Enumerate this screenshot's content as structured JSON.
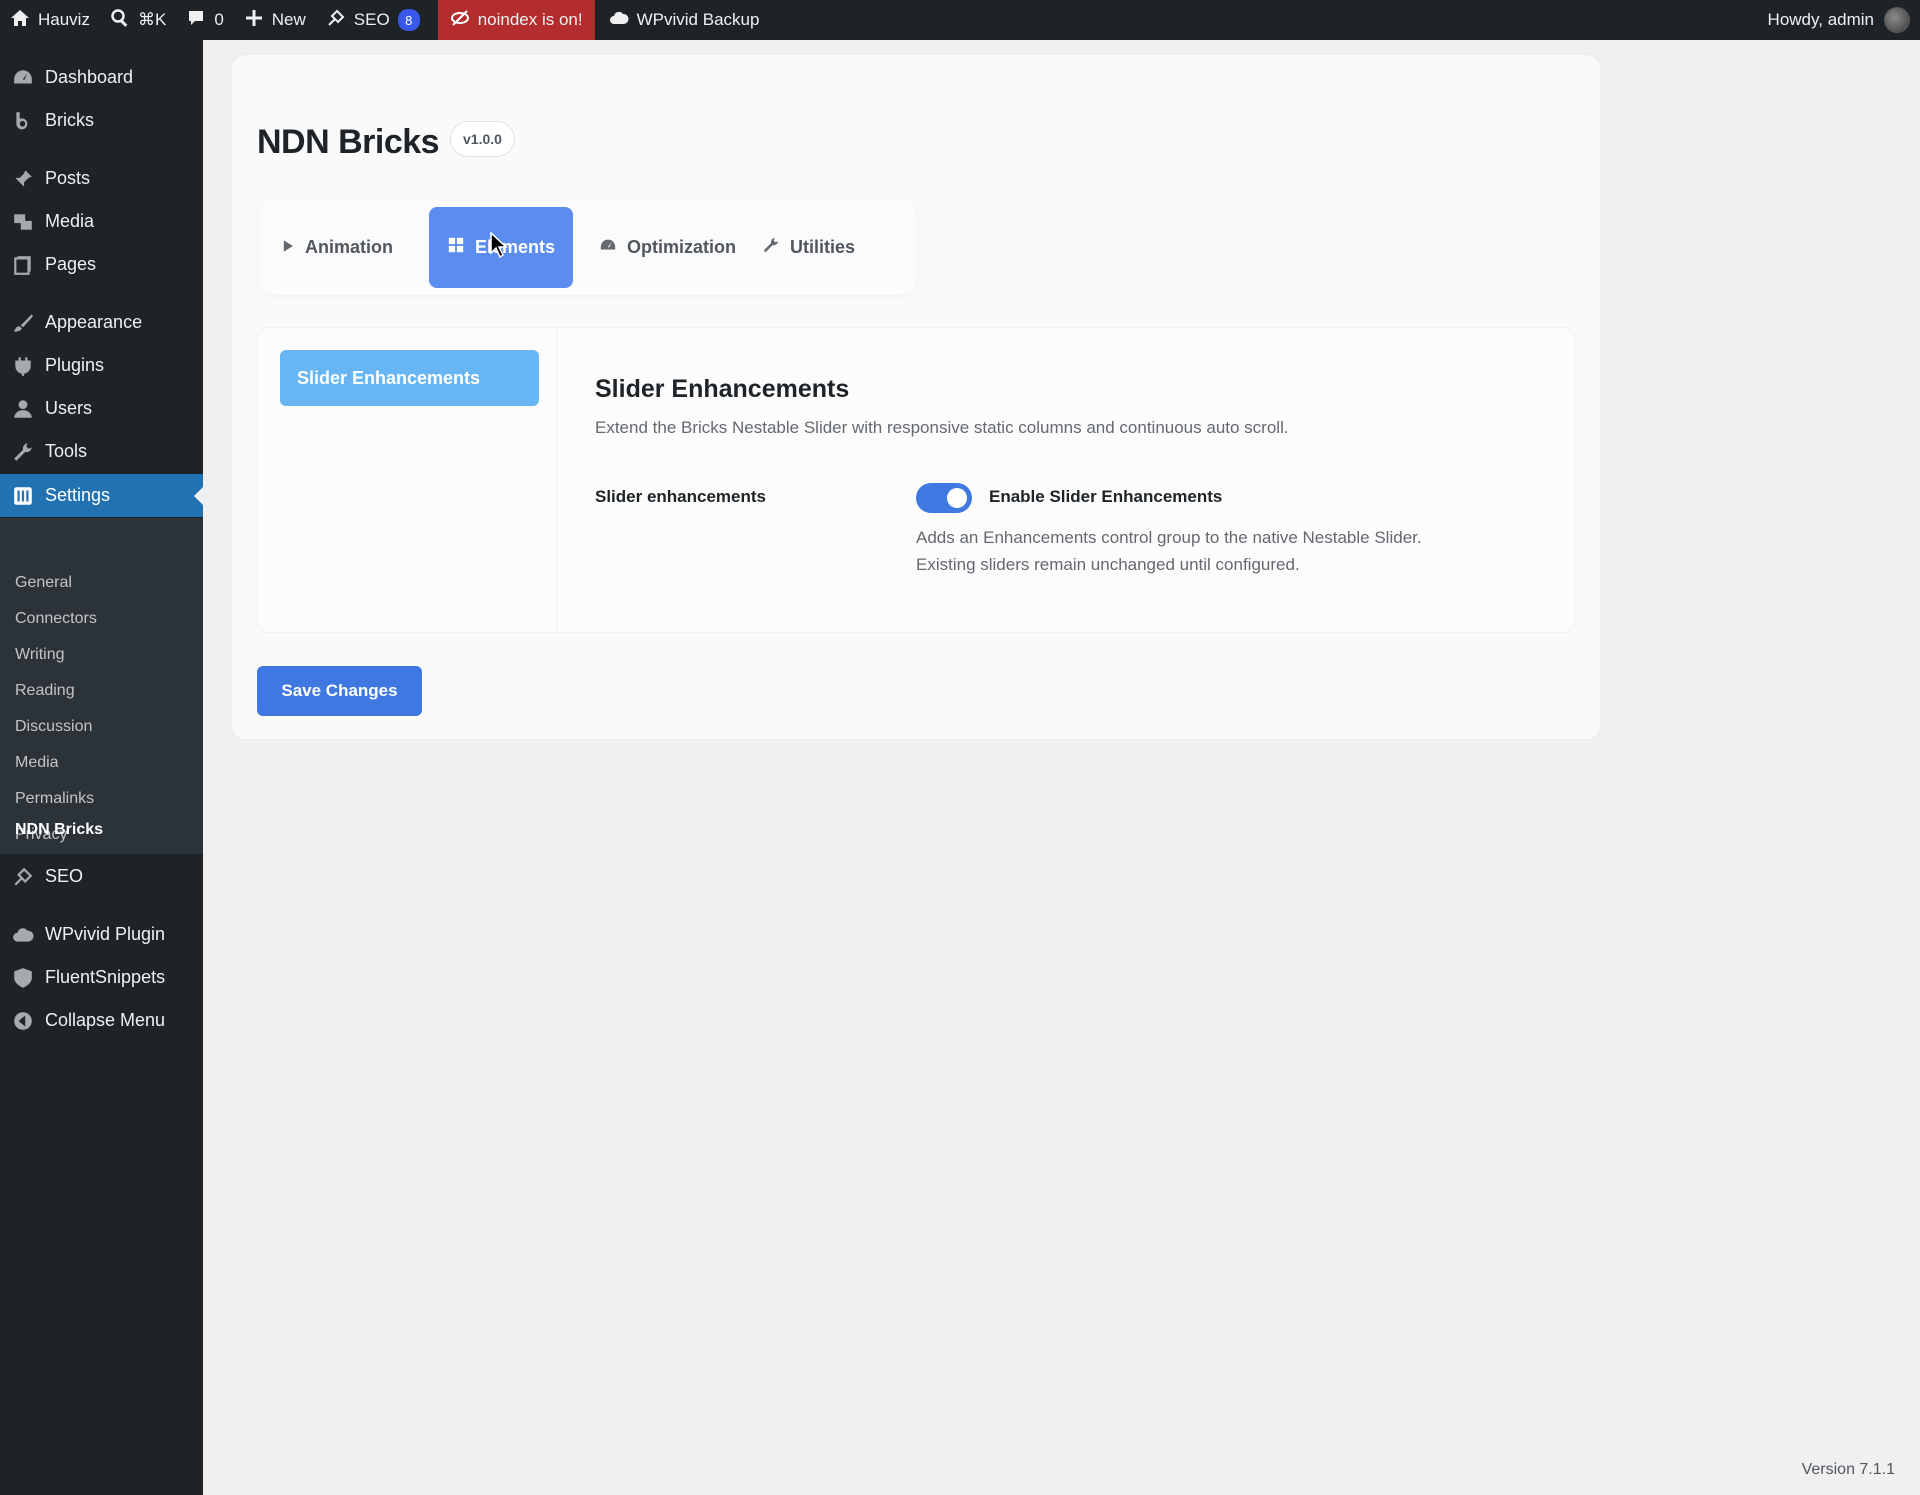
{
  "admin_bar": {
    "site_name": "Hauviz",
    "search_shortcut": "⌘K",
    "comments_count": "0",
    "new_label": "New",
    "seo_label": "SEO",
    "seo_count": "8",
    "noindex_label": "noindex is on!",
    "backup_label": "WPvivid Backup",
    "howdy": "Howdy, admin"
  },
  "sidebar": {
    "items": [
      {
        "label": "Dashboard",
        "icon": "dashboard-icon"
      },
      {
        "label": "Bricks",
        "icon": "bricks-icon"
      },
      {
        "label": "Posts",
        "icon": "pin-icon"
      },
      {
        "label": "Media",
        "icon": "media-icon"
      },
      {
        "label": "Pages",
        "icon": "pages-icon"
      },
      {
        "label": "Appearance",
        "icon": "brush-icon"
      },
      {
        "label": "Plugins",
        "icon": "plugin-icon"
      },
      {
        "label": "Users",
        "icon": "user-icon"
      },
      {
        "label": "Tools",
        "icon": "wrench-icon"
      },
      {
        "label": "Settings",
        "icon": "settings-icon"
      },
      {
        "label": "SEO",
        "icon": "seo-icon"
      },
      {
        "label": "WPvivid Plugin",
        "icon": "cloud-icon"
      },
      {
        "label": "FluentSnippets",
        "icon": "shield-icon"
      },
      {
        "label": "Collapse Menu",
        "icon": "collapse-icon"
      }
    ],
    "settings_submenu": [
      "General",
      "Connectors",
      "Writing",
      "Reading",
      "Discussion",
      "Media",
      "Permalinks",
      "Privacy",
      "NDN Bricks"
    ],
    "current_item": "Settings",
    "current_subitem": "NDN Bricks"
  },
  "page": {
    "title": "NDN Bricks",
    "version": "v1.0.0",
    "tabs": [
      {
        "label": "Animation",
        "icon": "play-icon"
      },
      {
        "label": "Elements",
        "icon": "grid-icon"
      },
      {
        "label": "Optimization",
        "icon": "gauge-icon"
      },
      {
        "label": "Utilities",
        "icon": "wrench-icon"
      }
    ],
    "active_tab": "Elements",
    "side_nav": [
      "Slider Enhancements"
    ],
    "section": {
      "title": "Slider Enhancements",
      "description": "Extend the Bricks Nestable Slider with responsive static columns and continuous auto scroll.",
      "field_label": "Slider enhancements",
      "toggle_label": "Enable Slider Enhancements",
      "toggle_on": true,
      "help_line1": "Adds an Enhancements control group to the native Nestable Slider.",
      "help_line2": "Existing sliders remain unchanged until configured."
    },
    "save_label": "Save Changes"
  },
  "footer": {
    "version": "Version 7.1.1"
  },
  "colors": {
    "accent": "#3e78e0",
    "tab_active": "#5b8def",
    "side_nav_active": "#67b6f3",
    "admin_bg": "#1d2327",
    "noindex_bg": "#b32d2e"
  }
}
